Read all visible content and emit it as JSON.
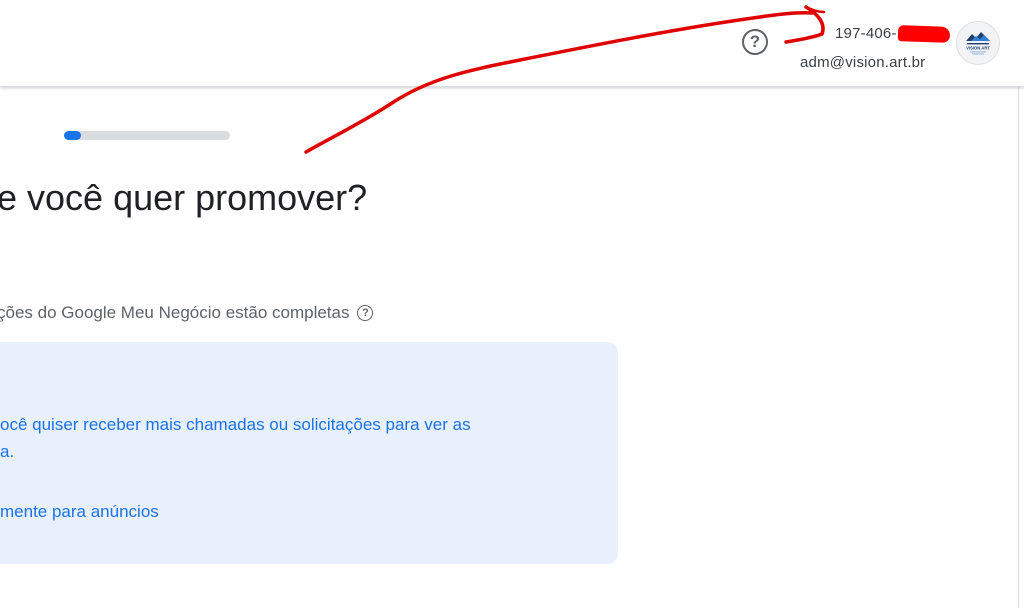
{
  "header": {
    "help_icon": "question-circle-icon",
    "account_id": "197-406-",
    "account_email": "adm@vision.art.br",
    "avatar_text": "VISION ART",
    "avatar_icon": "vision-art-logo"
  },
  "progress": {
    "fraction": 0.1
  },
  "main": {
    "question": "e você quer promover?",
    "info_line": "ções do Google Meu Negócio estão completas",
    "info_icon": "question-circle-icon"
  },
  "info_box": {
    "line1": "ocê quiser receber mais chamadas ou solicitações para ver as",
    "line2": "a.",
    "link": "mente para anúncios"
  },
  "colors": {
    "accent": "#1a73e8",
    "annotation": "#e00000",
    "box_bg": "#e8f0fe"
  }
}
